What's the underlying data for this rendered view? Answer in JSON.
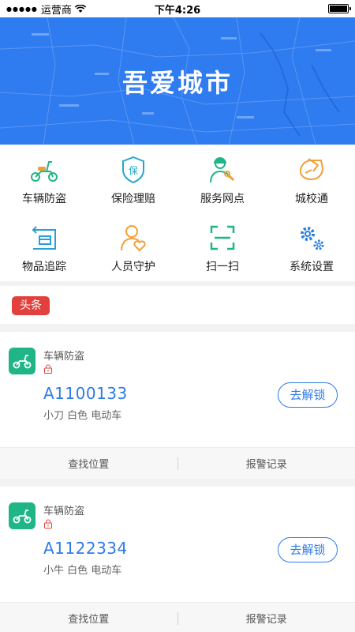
{
  "status_bar": {
    "carrier": "运营商",
    "time": "下午4:26"
  },
  "banner": {
    "title": "吾爱城市"
  },
  "grid": {
    "items": [
      {
        "label": "车辆防盗",
        "icon": "scooter-icon"
      },
      {
        "label": "保险理赔",
        "icon": "insurance-shield-icon"
      },
      {
        "label": "服务网点",
        "icon": "service-person-icon"
      },
      {
        "label": "城校通",
        "icon": "hand-card-icon"
      },
      {
        "label": "物品追踪",
        "icon": "package-tracking-icon"
      },
      {
        "label": "人员守护",
        "icon": "person-heart-icon"
      },
      {
        "label": "扫一扫",
        "icon": "scan-icon"
      },
      {
        "label": "系统设置",
        "icon": "gears-icon"
      }
    ]
  },
  "headline": {
    "tag": "头条"
  },
  "cards": [
    {
      "type": "车辆防盗",
      "plate": "A1100133",
      "desc": "小刀 白色 电动车",
      "unlock": "去解锁",
      "action_locate": "查找位置",
      "action_alarm": "报警记录"
    },
    {
      "type": "车辆防盗",
      "plate": "A1122334",
      "desc": "小牛 白色 电动车",
      "unlock": "去解锁",
      "action_locate": "查找位置",
      "action_alarm": "报警记录"
    }
  ],
  "colors": {
    "primary_blue": "#2e7be7",
    "banner_blue": "#2f7bf0",
    "tag_red": "#e2403d",
    "icon_green": "#20b587",
    "icon_orange": "#f0a038"
  }
}
